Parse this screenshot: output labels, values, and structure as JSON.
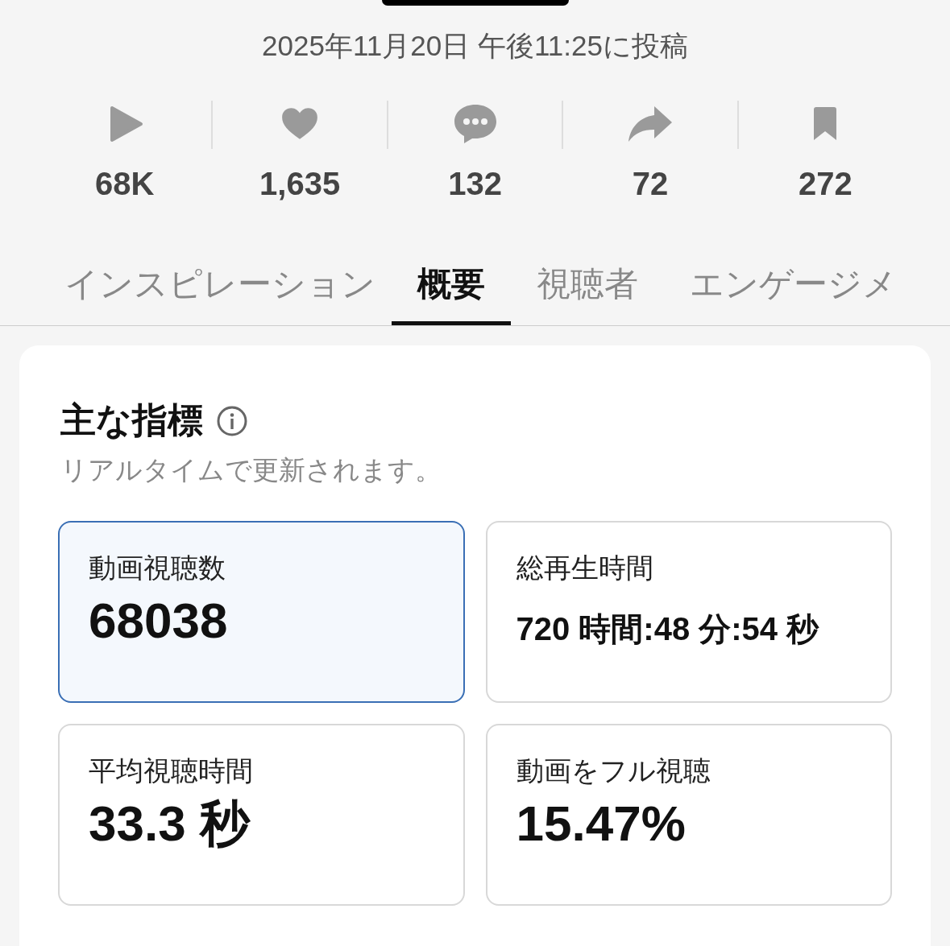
{
  "posted": "2025年11月20日 午後11:25に投稿",
  "stats": [
    {
      "kind": "play",
      "value": "68K"
    },
    {
      "kind": "like",
      "value": "1,635"
    },
    {
      "kind": "comment",
      "value": "132"
    },
    {
      "kind": "share",
      "value": "72"
    },
    {
      "kind": "save",
      "value": "272"
    }
  ],
  "tabs": [
    {
      "label": "インスピレーション",
      "selected": false
    },
    {
      "label": "概要",
      "selected": true
    },
    {
      "label": "視聴者",
      "selected": false
    },
    {
      "label": "エンゲージメ",
      "selected": false
    }
  ],
  "card": {
    "title": "主な指標",
    "subtitle": "リアルタイムで更新されます。",
    "metrics": [
      {
        "label": "動画視聴数",
        "value": "68038",
        "selected": true,
        "kind": "large"
      },
      {
        "label": "総再生時間",
        "value": "720 時間:48 分:54 秒",
        "selected": false,
        "kind": "small"
      },
      {
        "label": "平均視聴時間",
        "value": "33.3 秒",
        "selected": false,
        "kind": "large"
      },
      {
        "label": "動画をフル視聴",
        "value": "15.47%",
        "selected": false,
        "kind": "large"
      }
    ]
  }
}
